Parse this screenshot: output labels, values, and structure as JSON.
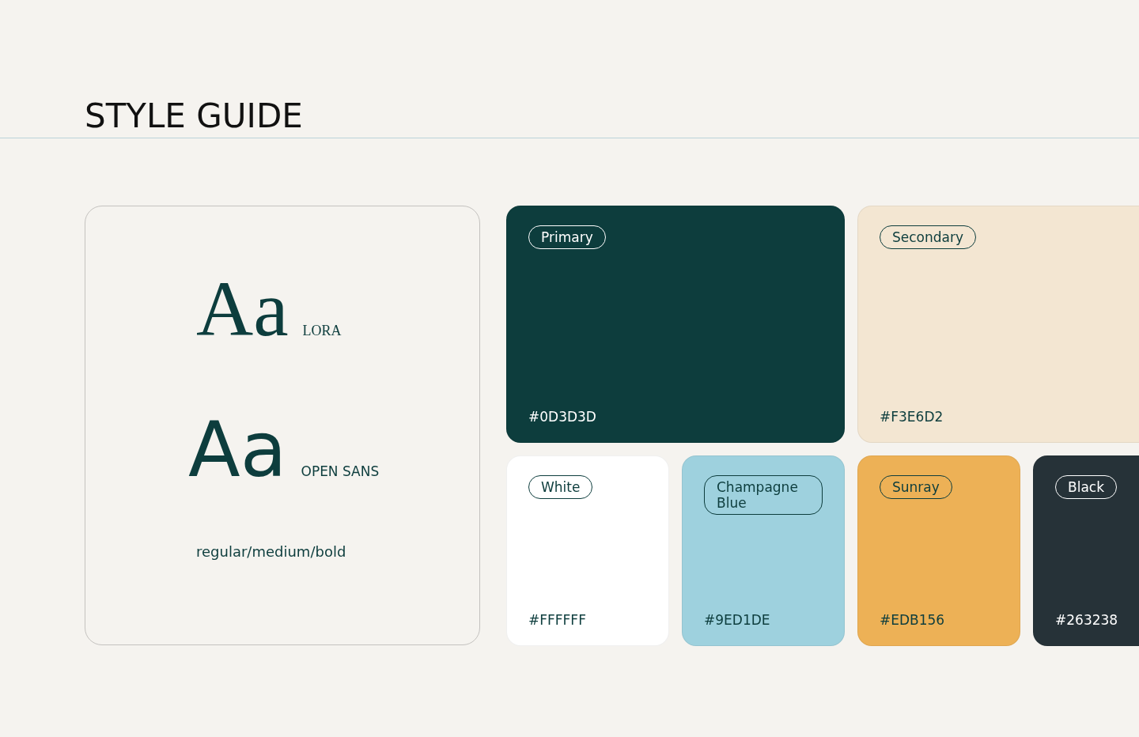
{
  "title": "STYLE GUIDE",
  "typography": {
    "samples": [
      {
        "kind": "serif",
        "glyphs": "Aa",
        "font": "LORA"
      },
      {
        "kind": "sans",
        "glyphs": "Aa",
        "font": "OPEN SANS"
      }
    ],
    "weights": "regular/medium/bold"
  },
  "swatches": [
    {
      "kind": "large",
      "label": "Primary",
      "hex": "#0D3D3D",
      "color": "#0d3d3d"
    },
    {
      "kind": "large",
      "label": "Secondary",
      "hex": "#F3E6D2",
      "color": "#f3e6d2"
    },
    {
      "kind": "small",
      "label": "White",
      "hex": "#FFFFFF",
      "color": "#ffffff"
    },
    {
      "kind": "small",
      "label": "Champagne Blue",
      "hex": "#9ED1DE",
      "color": "#9ed1de"
    },
    {
      "kind": "small",
      "label": "Sunray",
      "hex": "#EDB156",
      "color": "#edb156"
    },
    {
      "kind": "small",
      "label": "Black",
      "hex": "#263238",
      "color": "#263238"
    }
  ]
}
